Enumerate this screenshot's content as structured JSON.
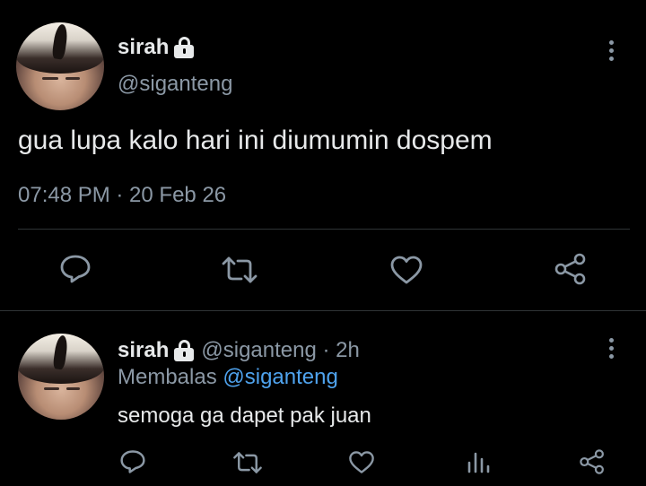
{
  "main_tweet": {
    "display_name": "sirah",
    "handle": "@siganteng",
    "text": "gua lupa kalo hari ini diumumin dospem",
    "timestamp": "07:48 PM · 20 Feb 26",
    "icons": [
      "lock-icon",
      "more-icon",
      "reply-icon",
      "retweet-icon",
      "like-icon",
      "share-icon"
    ]
  },
  "reply_tweet": {
    "display_name": "sirah",
    "handle_time": "@siganteng · 2h",
    "replying_label": "Membalas",
    "replying_to": "@siganteng",
    "text": "semoga ga dapet pak juan",
    "icons": [
      "lock-icon",
      "more-icon",
      "reply-icon",
      "retweet-icon",
      "like-icon",
      "analytics-icon",
      "share-icon"
    ]
  },
  "colors": {
    "background": "#000000",
    "text": "#e7e9ea",
    "muted": "#8b98a5",
    "link": "#4fa3ee",
    "divider": "#2f3336"
  }
}
